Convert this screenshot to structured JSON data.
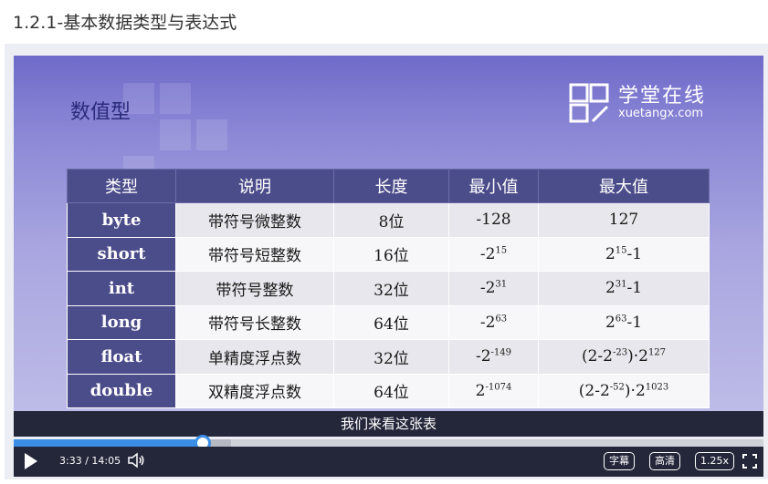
{
  "page": {
    "title": "1.2.1-基本数据类型与表达式"
  },
  "slide": {
    "heading": "数值型",
    "logo": {
      "name_cn": "学堂在线",
      "url": "xuetangx.com"
    },
    "table": {
      "headers": [
        "类型",
        "说明",
        "长度",
        "最小值",
        "最大值"
      ],
      "rows": [
        {
          "type": "byte",
          "desc": "带符号微整数",
          "length": "8位",
          "min": "-128",
          "max": "127"
        },
        {
          "type": "short",
          "desc": "带符号短整数",
          "length": "16位",
          "min_base": "-2",
          "min_exp": "15",
          "max_base": "2",
          "max_exp": "15",
          "max_tail": "-1"
        },
        {
          "type": "int",
          "desc": "带符号整数",
          "length": "32位",
          "min_base": "-2",
          "min_exp": "31",
          "max_base": "2",
          "max_exp": "31",
          "max_tail": "-1"
        },
        {
          "type": "long",
          "desc": "带符号长整数",
          "length": "64位",
          "min_base": "-2",
          "min_exp": "63",
          "max_base": "2",
          "max_exp": "63",
          "max_tail": "-1"
        },
        {
          "type": "float",
          "desc": "单精度浮点数",
          "length": "32位",
          "min_base": "-2",
          "min_exp": "-149",
          "max_pre": "(2-2",
          "max_pre_exp": "-23",
          "max_mid": ")·2",
          "max_exp2": "127"
        },
        {
          "type": "double",
          "desc": "双精度浮点数",
          "length": "64位",
          "min_base": "2",
          "min_exp": "-1074",
          "max_pre": "(2-2",
          "max_pre_exp": "-52",
          "max_mid": ")·2",
          "max_exp2": "1023"
        }
      ]
    }
  },
  "player": {
    "subtitle": "我们来看这张表",
    "current_time": "3:33",
    "time_separator": "/",
    "duration": "14:05",
    "progress_fraction": 0.2525,
    "buffer_fraction": 0.29,
    "buttons": {
      "captions": "字幕",
      "quality": "高清",
      "speed": "1.25x"
    },
    "icons": {
      "play": "play-icon",
      "volume": "volume-icon",
      "fullscreen": "fullscreen-icon"
    }
  }
}
